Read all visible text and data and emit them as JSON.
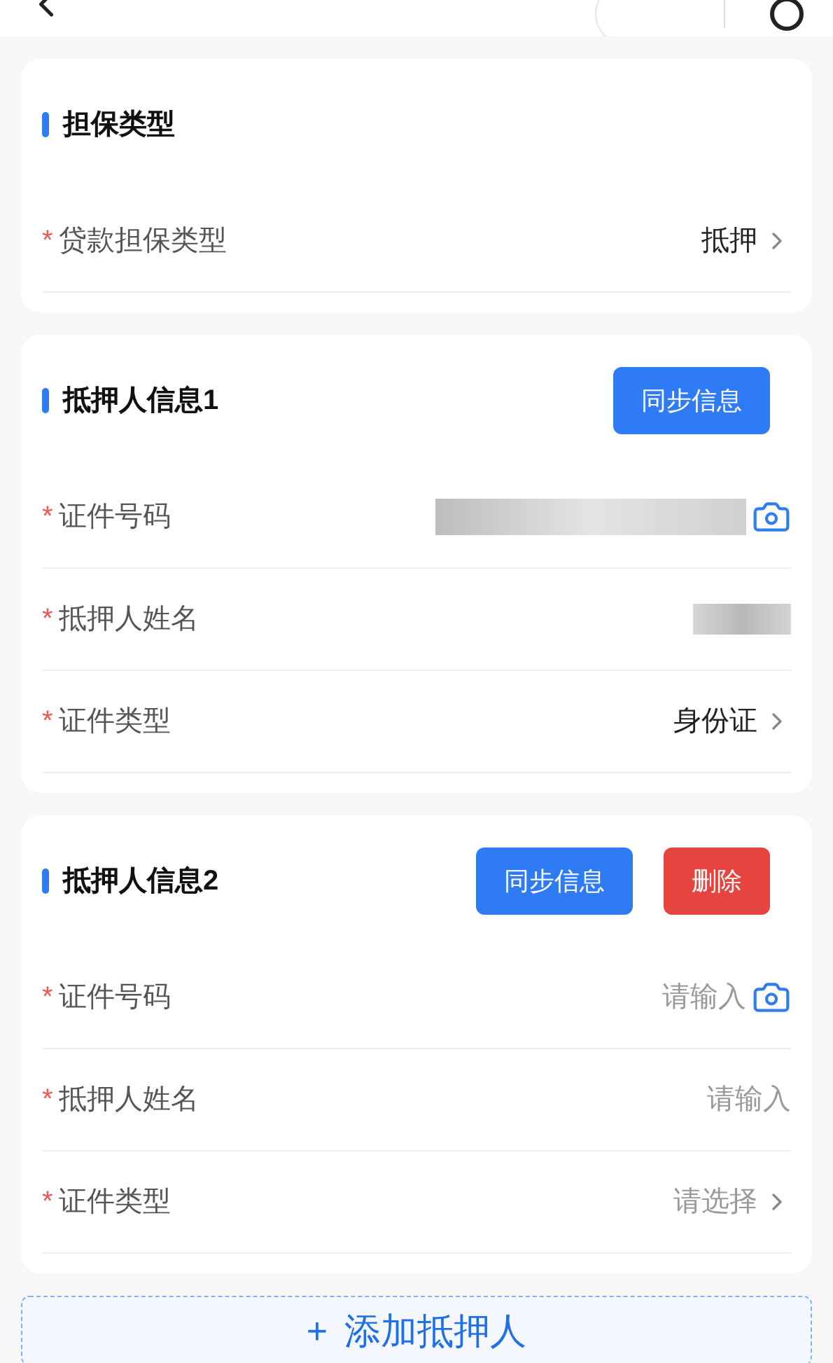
{
  "sections": [
    {
      "title": "担保类型",
      "rows": [
        {
          "mark": "*",
          "label": "贷款担保类型",
          "kind": "select",
          "value": "抵押",
          "redacted": false,
          "camera": false
        }
      ]
    },
    {
      "title": "抵押人信息1",
      "buttons": [
        {
          "label": "同步信息",
          "kind": "primary"
        }
      ],
      "rows": [
        {
          "mark": "*",
          "label": "证件号码",
          "kind": "input",
          "redacted": true,
          "camera": true
        },
        {
          "mark": "*",
          "label": "抵押人姓名",
          "kind": "input",
          "redacted": true,
          "camera": false
        },
        {
          "mark": "*",
          "label": "证件类型",
          "kind": "select",
          "value": "身份证",
          "redacted": false,
          "camera": false
        }
      ]
    },
    {
      "title": "抵押人信息2",
      "buttons": [
        {
          "label": "同步信息",
          "kind": "primary"
        },
        {
          "label": "删除",
          "kind": "danger"
        }
      ],
      "rows": [
        {
          "mark": "*",
          "label": "证件号码",
          "kind": "input",
          "placeholder": "请输入",
          "redacted": false,
          "camera": true
        },
        {
          "mark": "*",
          "label": "抵押人姓名",
          "kind": "input",
          "placeholder": "请输入",
          "redacted": false,
          "camera": false
        },
        {
          "mark": "*",
          "label": "证件类型",
          "kind": "select",
          "placeholder": "请选择",
          "redacted": false,
          "camera": false
        }
      ]
    }
  ],
  "add_button": {
    "icon": "+",
    "label": "添加抵押人"
  }
}
